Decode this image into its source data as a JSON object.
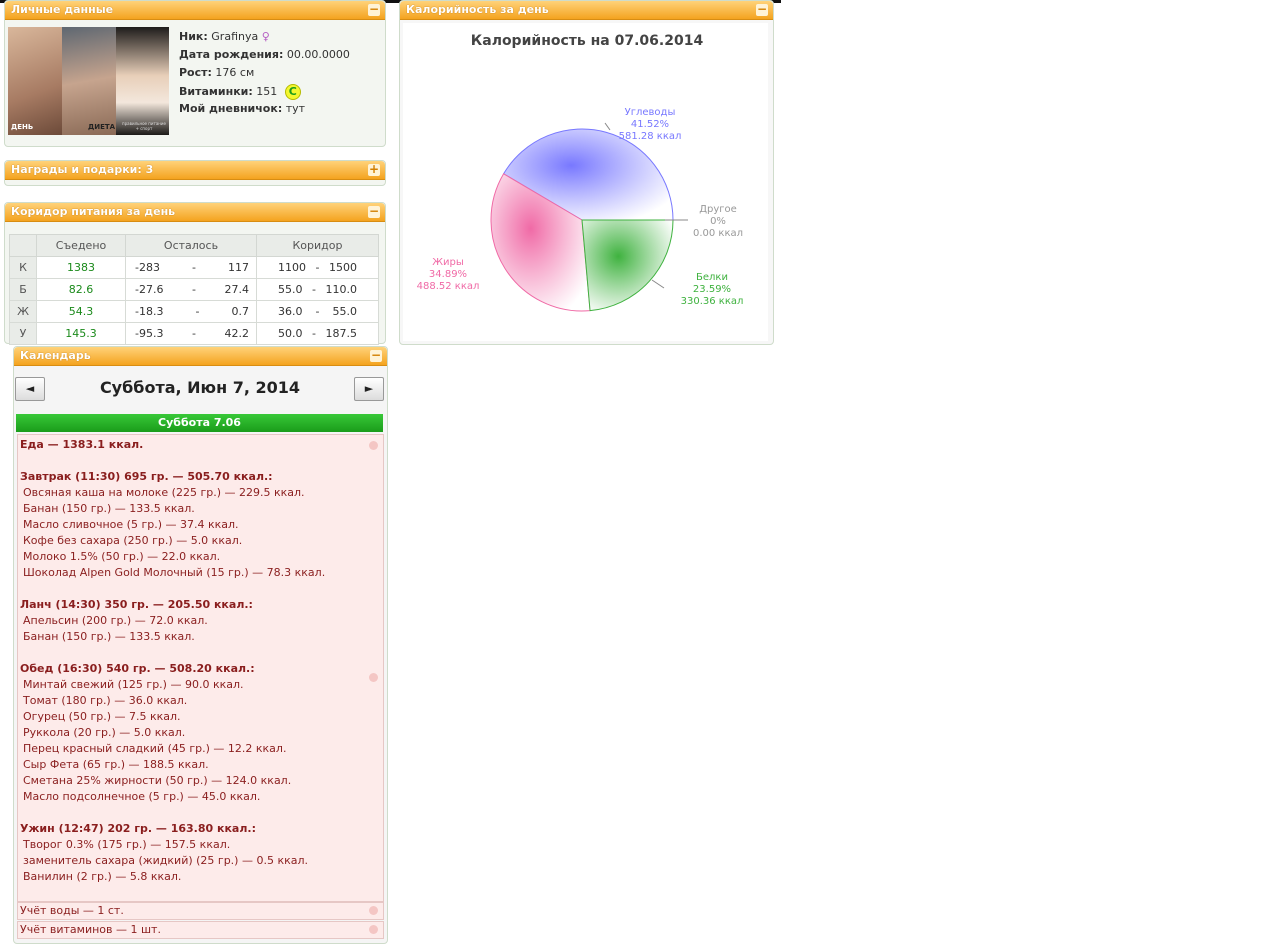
{
  "personal": {
    "title": "Личные данные",
    "toggle": "−",
    "photo_labels": [
      "ДЕНЬ",
      "ДИЕТА",
      "правильное питание + спорт"
    ],
    "fields": [
      {
        "label": "Ник:",
        "value": "Grafinya"
      },
      {
        "label": "Дата рождения:",
        "value": "00.00.0000"
      },
      {
        "label": "Рост:",
        "value": "176 см"
      },
      {
        "label": "Витаминки:",
        "value": "151",
        "badge": "C"
      },
      {
        "label": "Мой дневничок:",
        "value": "тут"
      }
    ]
  },
  "awards": {
    "title": "Награды и подарки: 3",
    "toggle": "+"
  },
  "corridor": {
    "title": "Коридор питания за день",
    "toggle": "−",
    "headers": [
      "",
      "Съедено",
      "Осталось",
      "Коридор"
    ],
    "rows": [
      {
        "label": "К",
        "eaten": "1383",
        "left_min": "-283",
        "left_max": "117",
        "c_min": "1100",
        "c_max": "1500"
      },
      {
        "label": "Б",
        "eaten": "82.6",
        "left_min": "-27.6",
        "left_max": "27.4",
        "c_min": "55.0",
        "c_max": "110.0"
      },
      {
        "label": "Ж",
        "eaten": "54.3",
        "left_min": "-18.3",
        "left_max": "0.7",
        "c_min": "36.0",
        "c_max": "55.0"
      },
      {
        "label": "У",
        "eaten": "145.3",
        "left_min": "-95.3",
        "left_max": "42.2",
        "c_min": "50.0",
        "c_max": "187.5"
      }
    ],
    "dash": "-"
  },
  "calories_panel": {
    "title": "Калорийность за день",
    "toggle": "−"
  },
  "chart_data": {
    "type": "pie",
    "title": "Калорийность на 07.06.2014",
    "slices": [
      {
        "name": "Углеводы",
        "percent": 41.52,
        "percent_label": "41.52%",
        "kcal_label": "581.28 ккал",
        "color": "#7878ff"
      },
      {
        "name": "Другое",
        "percent": 0,
        "percent_label": "0%",
        "kcal_label": "0.00 ккал",
        "color": "#999999"
      },
      {
        "name": "Белки",
        "percent": 23.59,
        "percent_label": "23.59%",
        "kcal_label": "330.36 ккал",
        "color": "#3fb23f"
      },
      {
        "name": "Жиры",
        "percent": 34.89,
        "percent_label": "34.89%",
        "kcal_label": "488.52 ккал",
        "color": "#f06aa6"
      }
    ]
  },
  "calendar": {
    "title": "Календарь",
    "toggle": "−",
    "prev": "◄",
    "next": "►",
    "date": "Суббота, Июн 7, 2014",
    "day_header": "Суббота 7.06",
    "food_total": "Еда — 1383.1 ккал.",
    "meals": [
      {
        "title": "Завтрак (11:30) 695 гр. — 505.70 ккал.:",
        "items": [
          "Овсяная каша на молоке (225 гр.) — 229.5 ккал.",
          "Банан (150 гр.) — 133.5 ккал.",
          "Масло сливочное (5 гр.) — 37.4 ккал.",
          "Кофе без сахара (250 гр.) — 5.0 ккал.",
          "Молоко 1.5% (50 гр.) — 22.0 ккал.",
          "Шоколад Alpen Gold Молочный (15 гр.) — 78.3 ккал."
        ]
      },
      {
        "title": "Ланч (14:30) 350 гр. — 205.50 ккал.:",
        "items": [
          "Апельсин (200 гр.) — 72.0 ккал.",
          "Банан (150 гр.) — 133.5 ккал."
        ]
      },
      {
        "title": "Обед (16:30) 540 гр. — 508.20 ккал.:",
        "items": [
          "Минтай свежий (125 гр.) — 90.0 ккал.",
          "Томат (180 гр.) — 36.0 ккал.",
          "Огурец (50 гр.) — 7.5 ккал.",
          "Руккола (20 гр.) — 5.0 ккал.",
          "Перец красный сладкий (45 гр.) — 12.2 ккал.",
          "Сыр Фета (65 гр.) — 188.5 ккал.",
          "Сметана 25% жирности (50 гр.) — 124.0 ккал.",
          "Масло подсолнечное (5 гр.) — 45.0 ккал."
        ]
      },
      {
        "title": "Ужин (12:47) 202 гр. — 163.80 ккал.:",
        "items": [
          "Творог 0.3% (175 гр.) — 157.5 ккал.",
          "заменитель сахара (жидкий) (25 гр.) — 0.5 ккал.",
          "Ванилин (2 гр.) — 5.8 ккал."
        ]
      }
    ],
    "water": "Учёт воды — 1 ст.",
    "vitamins": "Учёт витаминов — 1 шт."
  }
}
